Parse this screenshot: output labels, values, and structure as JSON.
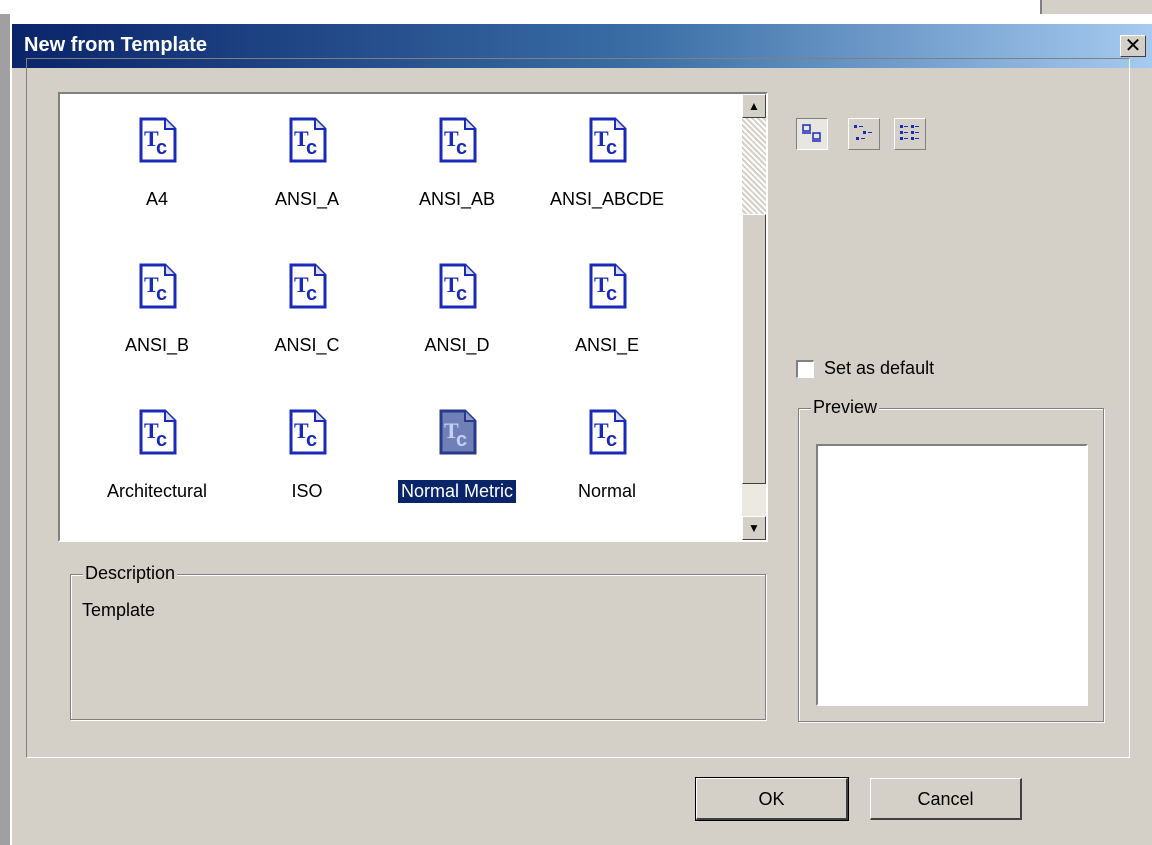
{
  "dialog": {
    "title": "New from Template",
    "close_glyph": "✕"
  },
  "templates": [
    {
      "label": "A4",
      "selected": false
    },
    {
      "label": "ANSI_A",
      "selected": false
    },
    {
      "label": "ANSI_AB",
      "selected": false
    },
    {
      "label": "ANSI_ABCDE",
      "selected": false
    },
    {
      "label": "ANSI_B",
      "selected": false
    },
    {
      "label": "ANSI_C",
      "selected": false
    },
    {
      "label": "ANSI_D",
      "selected": false
    },
    {
      "label": "ANSI_E",
      "selected": false
    },
    {
      "label": "Architectural",
      "selected": false
    },
    {
      "label": "ISO",
      "selected": false
    },
    {
      "label": "Normal Metric",
      "selected": true
    },
    {
      "label": "Normal",
      "selected": false
    }
  ],
  "view_buttons": [
    {
      "icon": "large-icons-view-icon",
      "active": true
    },
    {
      "icon": "small-icons-view-icon",
      "active": false
    },
    {
      "icon": "list-view-icon",
      "active": false
    }
  ],
  "set_default": {
    "label": "Set as default",
    "checked": false
  },
  "preview": {
    "title": "Preview"
  },
  "description": {
    "title": "Description",
    "text": "Template"
  },
  "buttons": {
    "ok": "OK",
    "cancel": "Cancel"
  },
  "colors": {
    "title_start": "#0a246a",
    "title_end": "#a6caf0",
    "dialog_bg": "#d4d0c8",
    "selection": "#0a246a",
    "icon_blue": "#1a2ab8"
  }
}
